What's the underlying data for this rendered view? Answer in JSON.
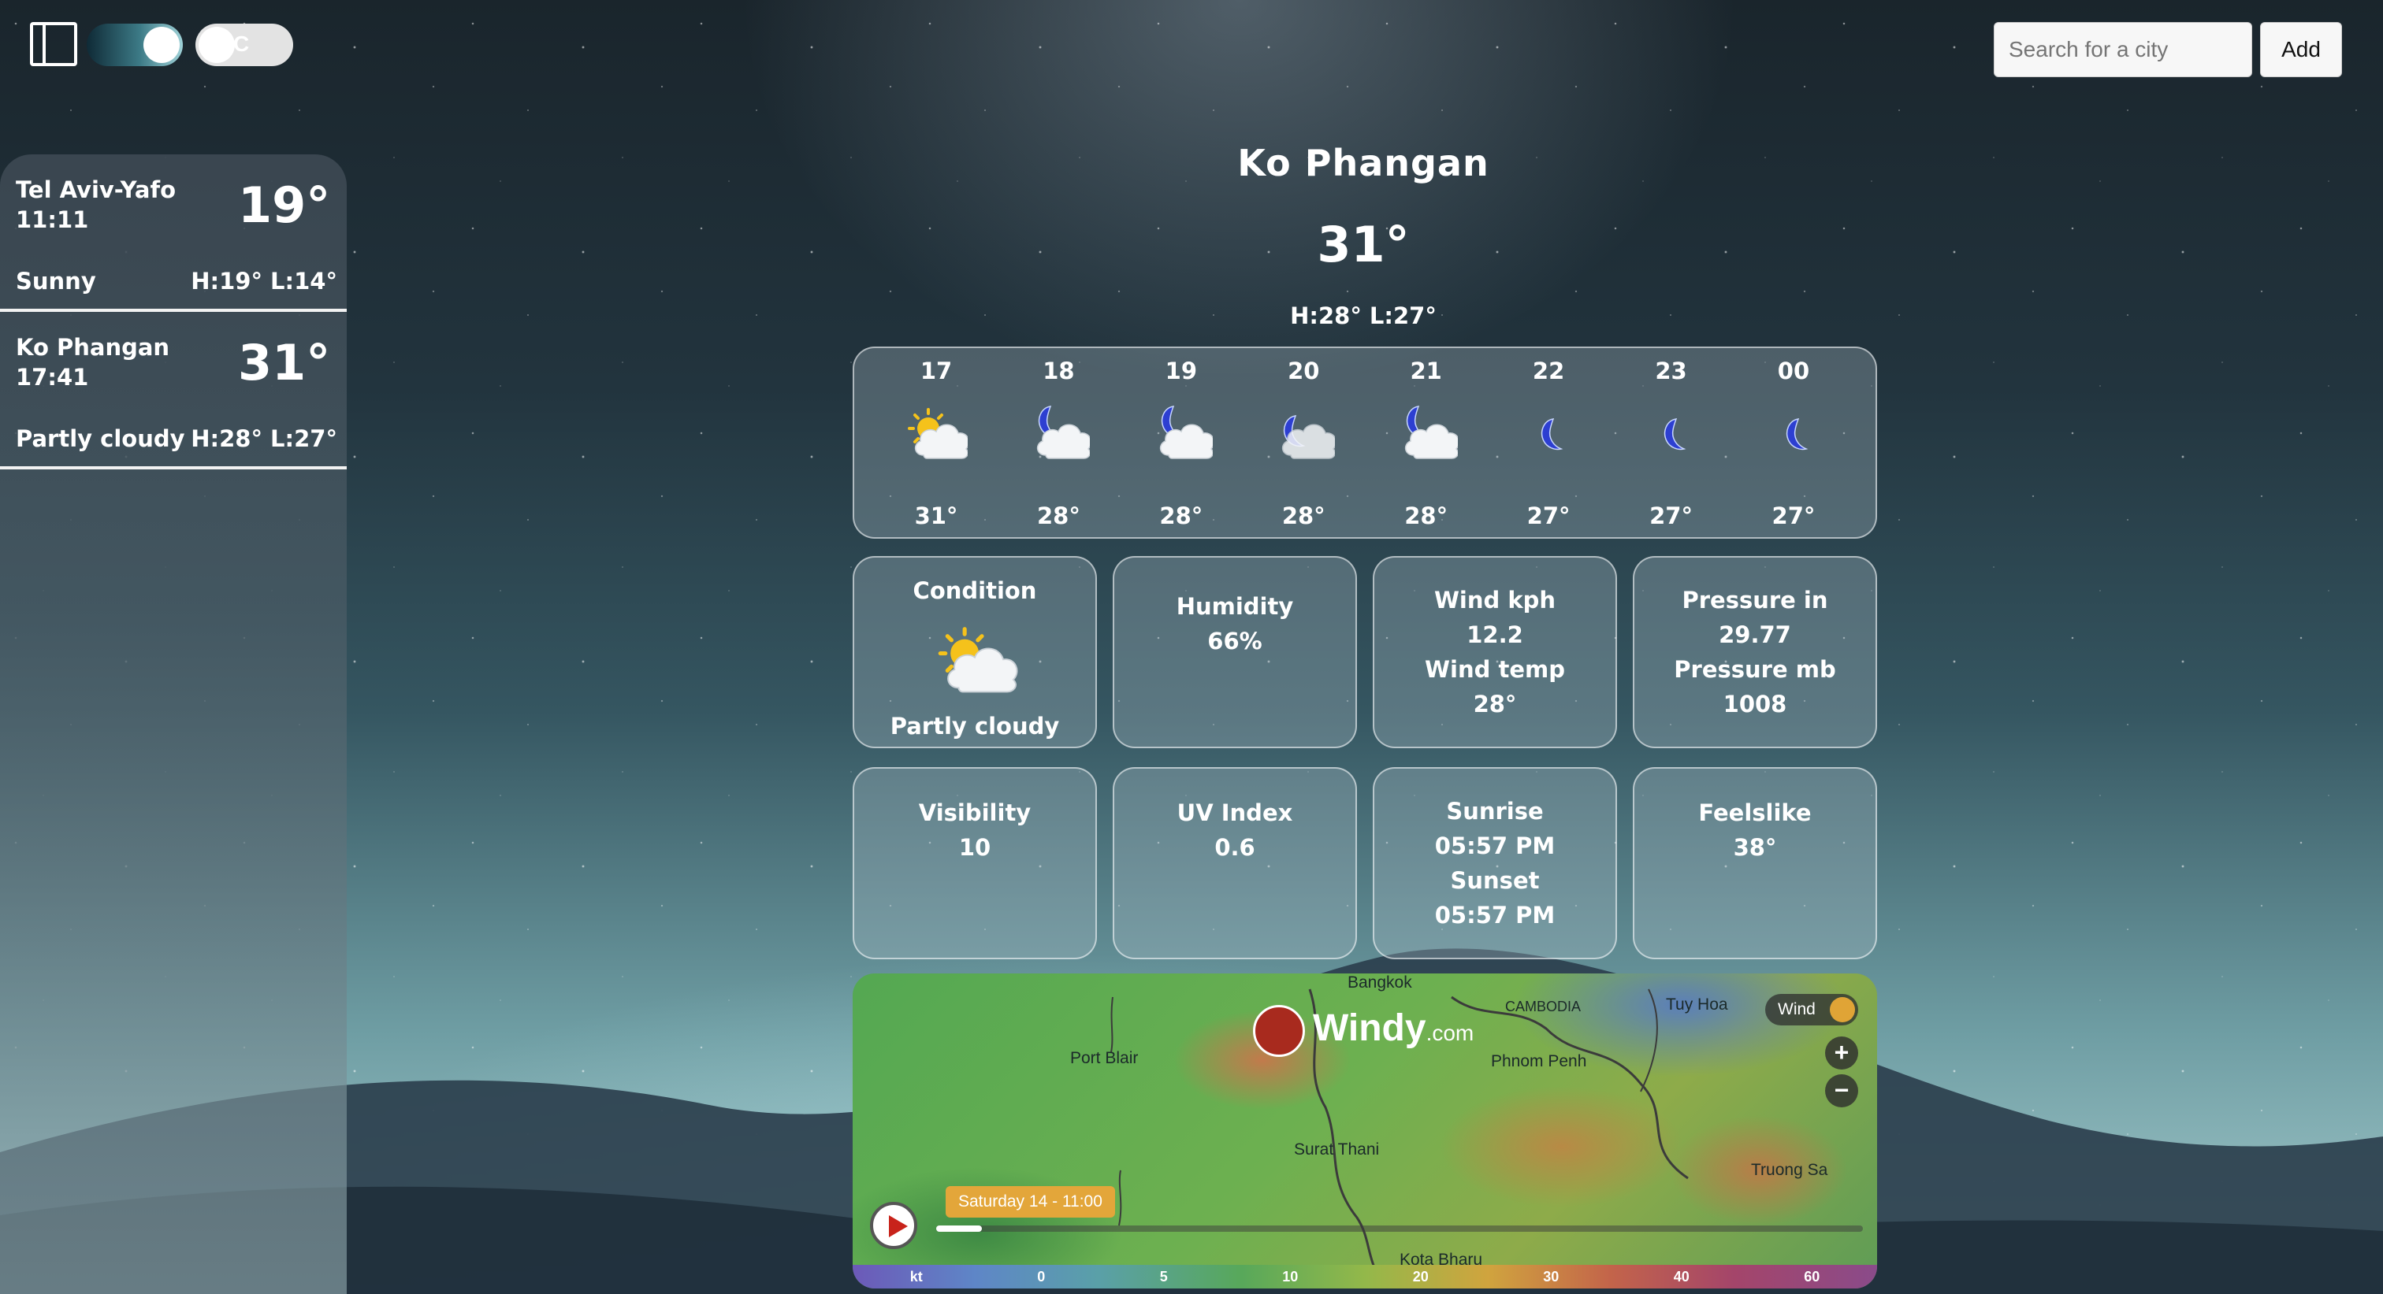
{
  "controls": {
    "sidebar_toggle": "sidebar-panel-icon",
    "unit_toggle_label": "C"
  },
  "search": {
    "placeholder": "Search for a city",
    "add_label": "Add"
  },
  "cities": [
    {
      "name": "Tel Aviv-Yafo",
      "time": "11:11",
      "temp": "19°",
      "condition": "Sunny",
      "hilo": "H:19° L:14°"
    },
    {
      "name": "Ko Phangan",
      "time": "17:41",
      "temp": "31°",
      "condition": "Partly cloudy",
      "hilo": "H:28° L:27°"
    }
  ],
  "current": {
    "city": "Ko Phangan",
    "temp": "31°",
    "hilo": "H:28° L:27°"
  },
  "hourly": [
    {
      "hour": "17",
      "icon": "partly-cloudy-day-icon",
      "temp": "31°"
    },
    {
      "hour": "18",
      "icon": "partly-cloudy-night-icon",
      "temp": "28°"
    },
    {
      "hour": "19",
      "icon": "partly-cloudy-night-icon",
      "temp": "28°"
    },
    {
      "hour": "20",
      "icon": "cloudy-night-icon",
      "temp": "28°"
    },
    {
      "hour": "21",
      "icon": "partly-cloudy-night-icon",
      "temp": "28°"
    },
    {
      "hour": "22",
      "icon": "clear-night-icon",
      "temp": "27°"
    },
    {
      "hour": "23",
      "icon": "clear-night-icon",
      "temp": "27°"
    },
    {
      "hour": "00",
      "icon": "clear-night-icon",
      "temp": "27°"
    }
  ],
  "details": {
    "condition_label": "Condition",
    "condition_value": "Partly cloudy",
    "humidity_label": "Humidity",
    "humidity_value": "66%",
    "wind_kph_label": "Wind kph",
    "wind_kph_value": "12.2",
    "wind_temp_label": "Wind temp",
    "wind_temp_value": "28°",
    "pressure_in_label": "Pressure in",
    "pressure_in_value": "29.77",
    "pressure_mb_label": "Pressure mb",
    "pressure_mb_value": "1008",
    "visibility_label": "Visibility",
    "visibility_value": "10",
    "uv_label": "UV Index",
    "uv_value": "0.6",
    "sunrise_label": "Sunrise",
    "sunrise_value": "05:57 PM",
    "sunset_label": "Sunset",
    "sunset_value": "05:57 PM",
    "feelslike_label": "Feelslike",
    "feelslike_value": "38°"
  },
  "map": {
    "brand": "Windy",
    "brand_suffix": ".com",
    "layer_label": "Wind",
    "date_label": "Saturday 14 - 11:00",
    "places": [
      "Bangkok",
      "CAMBODIA",
      "Tuy Hoa",
      "Port Blair",
      "Phnom Penh",
      "Surat Thani",
      "Truong Sa",
      "Kota Bharu"
    ],
    "scale_unit": "kt",
    "scale_ticks": [
      "0",
      "5",
      "10",
      "20",
      "30",
      "40",
      "60"
    ],
    "zoom_in": "+",
    "zoom_out": "−"
  }
}
